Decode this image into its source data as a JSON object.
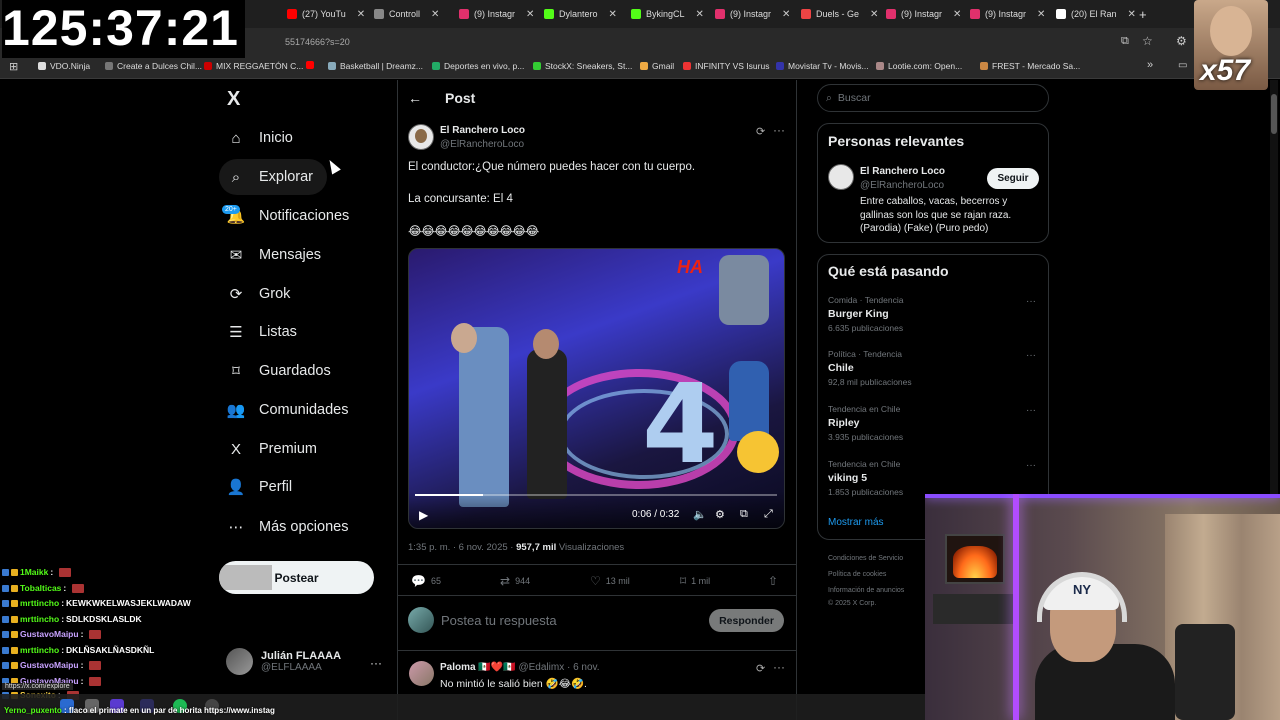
{
  "overlay": {
    "timer": "125:37:21",
    "meme_multiplier": "x57"
  },
  "browser": {
    "tabs": [
      {
        "label": "(27) YouTu",
        "color": "#ff0000"
      },
      {
        "label": "Controll",
        "color": "#888888"
      },
      {
        "label": "(9) Instagr",
        "color": "#e1306c"
      },
      {
        "label": "Dylantero",
        "color": "#53fc18"
      },
      {
        "label": "BykingCL",
        "color": "#53fc18"
      },
      {
        "label": "(9) Instagr",
        "color": "#e1306c"
      },
      {
        "label": "Duels - Ge",
        "color": "#e44"
      },
      {
        "label": "(9) Instagr",
        "color": "#e1306c"
      },
      {
        "label": "(9) Instagr",
        "color": "#e1306c"
      },
      {
        "label": "(20) El Ran",
        "color": "#ffffff"
      }
    ],
    "url": "55174666?s=20",
    "bookmarks": [
      "VDO.Ninja",
      "Create a Dulces Chil...",
      "MIX REGGAETÓN C...",
      "",
      "Basketball | Dreamz...",
      "Deportes en vivo, p...",
      "StockX: Sneakers, St...",
      "Gmail",
      "INFINITY VS Isurus",
      "Movistar Tv - Movis...",
      "Lootie.com: Open...",
      "FREST - Mercado Sa..."
    ]
  },
  "nav": {
    "logo": "X",
    "items": [
      {
        "label": "Inicio"
      },
      {
        "label": "Explorar"
      },
      {
        "label": "Notificaciones"
      },
      {
        "label": "Mensajes"
      },
      {
        "label": "Grok"
      },
      {
        "label": "Listas"
      },
      {
        "label": "Guardados"
      },
      {
        "label": "Comunidades"
      },
      {
        "label": "Premium"
      },
      {
        "label": "Perfil"
      },
      {
        "label": "Más opciones"
      }
    ],
    "notif_badge": "20+",
    "post_button": "Postear",
    "profile": {
      "name": "Julián FLAAAA",
      "handle": "@ELFLAAAA"
    }
  },
  "post": {
    "header": "Post",
    "author": {
      "name": "El Ranchero Loco",
      "handle": "@ElRancheroLoco"
    },
    "lines": [
      "El conductor:¿Que número puedes hacer con tu cuerpo.",
      "La concursante: El 4",
      "😂😂😂😂😂😂😂😂😂😂"
    ],
    "video": {
      "time": "0:06 / 0:32",
      "progress": 0.1875,
      "overlay_text": "HA",
      "number": "4"
    },
    "meta": {
      "date": "1:35 p. m. · 6 nov. 2025 · ",
      "views": "957,7 mil",
      "views_label": " Visualizaciones"
    },
    "stats": {
      "replies": "65",
      "reposts": "944",
      "likes": "13 mil",
      "bookmarks": "1 mil"
    },
    "reply_placeholder": "Postea tu respuesta",
    "reply_button": "Responder",
    "comment": {
      "name": "Paloma 🇲🇽❤️🇲🇽",
      "handle": "@Edalimx · 6 nov.",
      "text": "No mintió le salió bien 🤣😂🤣."
    }
  },
  "sidebar": {
    "search_placeholder": "Buscar",
    "relevant_title": "Personas relevantes",
    "relevant": {
      "name": "El Ranchero Loco",
      "handle": "@ElRancheroLoco",
      "follow": "Seguir",
      "bio": "Entre caballos, vacas, becerros y gallinas son los que se rajan raza. (Parodia) (Fake) (Puro pedo)"
    },
    "trends_title": "Qué está pasando",
    "trends": [
      {
        "meta": "Comida · Tendencia",
        "name": "Burger King",
        "count": "6.635 publicaciones"
      },
      {
        "meta": "Política · Tendencia",
        "name": "Chile",
        "count": "92,8 mil publicaciones"
      },
      {
        "meta": "Tendencia en Chile",
        "name": "Ripley",
        "count": "3.935 publicaciones"
      },
      {
        "meta": "Tendencia en Chile",
        "name": "viking 5",
        "count": "1.853 publicaciones"
      }
    ],
    "show_more": "Mostrar más",
    "footer": [
      "Condiciones de Servicio",
      "Política de cookies",
      "Información de anuncios",
      "© 2025 X Corp."
    ]
  },
  "chat": [
    {
      "user": "1Maikk",
      "color": "#53fc18",
      "msg": ""
    },
    {
      "user": "Tobalticas",
      "color": "#53fc18",
      "msg": ""
    },
    {
      "user": "mrttincho",
      "color": "#53fc18",
      "msg": "KEWKWKELWASJEKLWADAW"
    },
    {
      "user": "mrttincho",
      "color": "#53fc18",
      "msg": "SDLKDSKLASLDK"
    },
    {
      "user": "GustavoMaipu",
      "color": "#c8a2ff",
      "msg": ""
    },
    {
      "user": "mrttincho",
      "color": "#53fc18",
      "msg": "DKLÑSAKLÑASDKÑL"
    },
    {
      "user": "GustavoMaipu",
      "color": "#c8a2ff",
      "msg": ""
    },
    {
      "user": "GustavoMaipu",
      "color": "#c8a2ff",
      "msg": ""
    },
    {
      "user": "Sonexito",
      "color": "#ffd84a",
      "msg": ""
    }
  ],
  "status_url": "https://x.com/explore",
  "last_chat": {
    "user": "Yerno_puxento",
    "msg": "flaco el primate en un par de horita https://www.instag"
  }
}
